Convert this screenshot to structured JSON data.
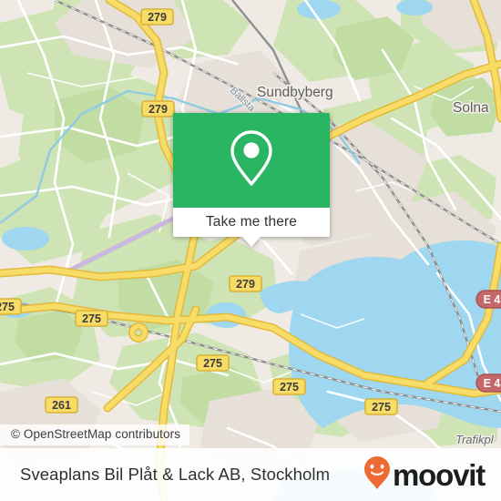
{
  "map": {
    "provider": "OpenStreetMap",
    "attribution": "© OpenStreetMap contributors",
    "city_labels": [
      {
        "name": "Sundbyberg"
      },
      {
        "name": "Solna"
      }
    ],
    "water_labels": [
      {
        "name": "Bällsta"
      }
    ],
    "edge_labels": [
      {
        "name": "Trafikpl"
      }
    ],
    "road_shields": [
      {
        "ref": "279"
      },
      {
        "ref": "279"
      },
      {
        "ref": "279"
      },
      {
        "ref": "275"
      },
      {
        "ref": "275"
      },
      {
        "ref": "275"
      },
      {
        "ref": "275"
      },
      {
        "ref": "275"
      },
      {
        "ref": "261"
      }
    ],
    "motorway_shields": [
      {
        "ref": "E 4"
      },
      {
        "ref": "E 4"
      }
    ],
    "colors": {
      "land": "#efebe4",
      "green": "#cfe4b4",
      "green_dark": "#c2dda4",
      "water": "#9ed7ef",
      "residential": "#e6e0d8",
      "highway": "#f5d24b",
      "highway_casing": "#e3b93a",
      "road": "#ffffff",
      "rail": "#8c8c8c",
      "shield_text": "#3c3c3c",
      "motorway_shield": "#c4676b"
    }
  },
  "popup": {
    "icon": "map-pin-icon",
    "button_label": "Take me there",
    "accent_color": "#2ab563"
  },
  "footer": {
    "title": "Sveaplans Bil Plåt & Lack AB, Stockholm",
    "brand_name": "moovit",
    "brand_icon": "moovit-smile-pin-icon",
    "brand_color": "#ee6a33"
  }
}
